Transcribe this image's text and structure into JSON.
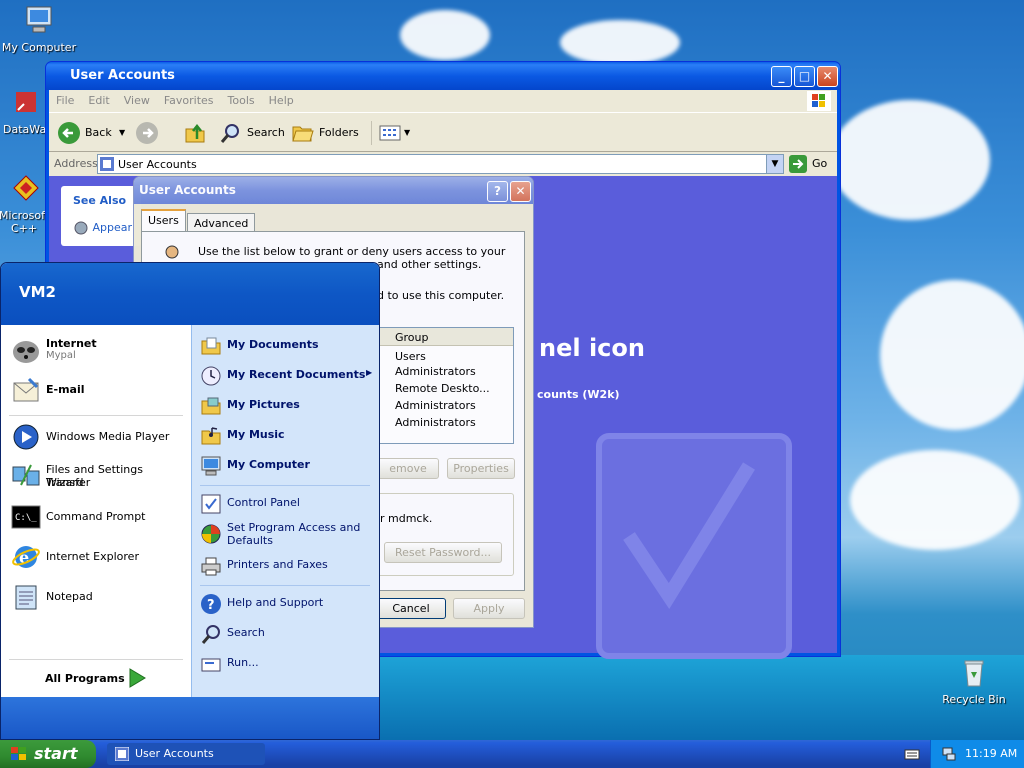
{
  "desktop": {
    "icons": [
      {
        "label": "My Computer"
      },
      {
        "label": "DataWar"
      },
      {
        "label": "Microsoft C++"
      },
      {
        "label": "Recycle Bin"
      }
    ]
  },
  "explorer": {
    "title": "User Accounts",
    "menu": [
      "File",
      "Edit",
      "View",
      "Favorites",
      "Tools",
      "Help"
    ],
    "toolbar": {
      "back": "Back",
      "search": "Search",
      "folders": "Folders"
    },
    "address_label": "Address",
    "address_value": "User Accounts",
    "go": "Go",
    "see_also": "See Also",
    "see_also_item": "Appear",
    "bg_title": "nel icon",
    "bg_sub": "counts (W2k)"
  },
  "dialog": {
    "title": "User Accounts",
    "tabs": [
      "Users",
      "Advanced"
    ],
    "desc1": "Use the list below to grant or deny users access to your",
    "desc2": "and other settings.",
    "desc3": "d to use this computer.",
    "group_header": "Group",
    "groups": [
      "Users",
      "Administrators",
      "Remote Deskto...",
      "Administrators",
      "Administrators"
    ],
    "remove": "emove",
    "properties": "Properties",
    "pwd_text": "r mdmck.",
    "reset": "Reset Password...",
    "cancel": "Cancel",
    "apply": "Apply"
  },
  "startmenu": {
    "user": "VM2",
    "pinned": [
      {
        "title": "Internet",
        "sub": "Mypal"
      },
      {
        "title": "E-mail",
        "sub": ""
      }
    ],
    "recent": [
      "Windows Media Player",
      "Files and Settings Transfer",
      "Wizard",
      "Command Prompt",
      "Internet Explorer",
      "Notepad"
    ],
    "all_programs": "All Programs",
    "right": [
      "My Documents",
      "My Recent Documents",
      "My Pictures",
      "My Music",
      "My Computer",
      "Control Panel",
      "Set Program Access and",
      "Defaults",
      "Printers and Faxes",
      "Help and Support",
      "Search",
      "Run..."
    ]
  },
  "taskbar": {
    "start": "start",
    "task": "User Accounts",
    "clock": "11:19 AM"
  }
}
